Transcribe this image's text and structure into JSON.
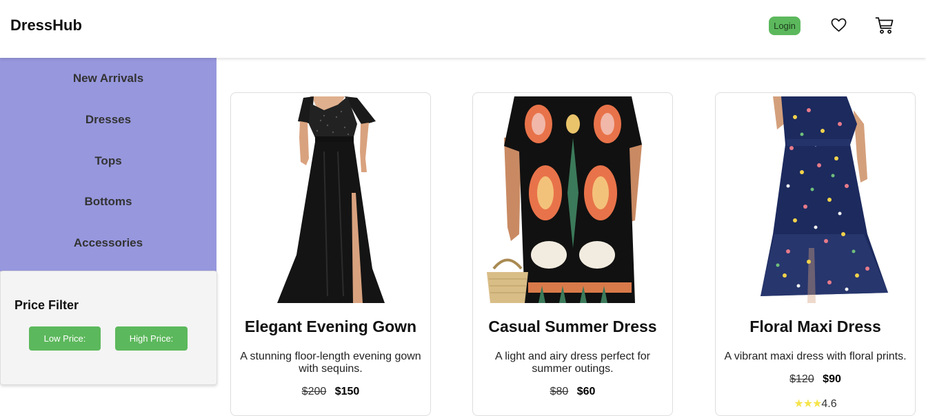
{
  "header": {
    "brand": "DressHub",
    "login_label": "Login",
    "icons": [
      "heart-icon",
      "cart-icon"
    ]
  },
  "sidebar": {
    "items": [
      {
        "label": "New Arrivals"
      },
      {
        "label": "Dresses"
      },
      {
        "label": "Tops"
      },
      {
        "label": "Bottoms"
      },
      {
        "label": "Accessories"
      }
    ],
    "background": "#9797de"
  },
  "filter": {
    "title": "Price Filter",
    "low_label": "Low Price:",
    "high_label": "High Price:",
    "button_color": "#5cb85c"
  },
  "products": [
    {
      "name": "Elegant Evening Gown",
      "description": "A stunning floor-length evening gown with sequins.",
      "old_price": "$200",
      "price": "$150"
    },
    {
      "name": "Casual Summer Dress",
      "description": "A light and airy dress perfect for summer outings.",
      "old_price": "$80",
      "price": "$60"
    },
    {
      "name": "Floral Maxi Dress",
      "description": "A vibrant maxi dress with floral prints.",
      "old_price": "$120",
      "price": "$90",
      "stars": "★★★",
      "rating": "4.6"
    }
  ]
}
